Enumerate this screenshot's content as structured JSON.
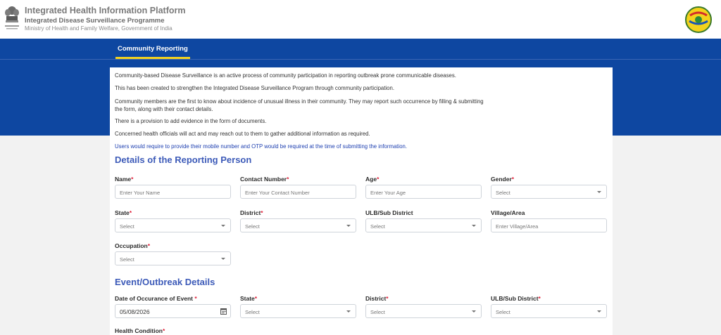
{
  "header": {
    "title": "Integrated Health Information Platform",
    "subtitle": "Integrated Disease Surveillance Programme",
    "ministry": "Ministry of Health and Family Welfare, Government of India",
    "emblem_icon": "state-emblem-icon",
    "logo_icon": "ihip-globe-logo-icon"
  },
  "nav": {
    "active_tab": "Community Reporting",
    "accent": "#0e47a1",
    "underline": "#f4d31f"
  },
  "intro": [
    "Community-based Disease Surveillance is an active process of community participation in reporting outbreak prone communicable diseases.",
    "This has been created to strengthen the Integrated Disease Surveillance Program through community participation.",
    "Community members are the first to know about incidence of unusual illness in their community. They may report such occurrence by filling & submitting",
    "the form, along with their contact details.",
    "There is a provision to add evidence in the form of documents.",
    "Concerned health officials will act and may reach out to them to gather additional information as required.",
    "Users would require to provide their mobile number and OTP would be required at the time of submitting the information."
  ],
  "reporting_person": {
    "title": "Details of the Reporting Person",
    "name_label": "Name",
    "name_placeholder": "Enter Your Name",
    "contact_label": "Contact Number",
    "contact_placeholder": "Enter Your Contact Number",
    "age_label": "Age",
    "age_placeholder": "Enter Your Age",
    "gender_label": "Gender",
    "gender_value": "Select",
    "state_label": "State",
    "state_value": "Select",
    "district_label": "District",
    "district_value": "Select",
    "ulb_label": "ULB/Sub District",
    "ulb_value": "Select",
    "village_label": "Village/Area",
    "village_placeholder": "Enter Village/Area",
    "occupation_label": "Occupation",
    "occupation_value": "Select"
  },
  "event": {
    "title": "Event/Outbreak Details",
    "date_label": "Date of Occurance of Event",
    "date_value": "05/08/2026",
    "state_label": "State",
    "state_value": "Select",
    "district_label": "District",
    "district_value": "Select",
    "ulb_label": "ULB/Sub District",
    "ulb_value": "Select",
    "health_label": "Health Condition"
  },
  "required_mark": "*"
}
